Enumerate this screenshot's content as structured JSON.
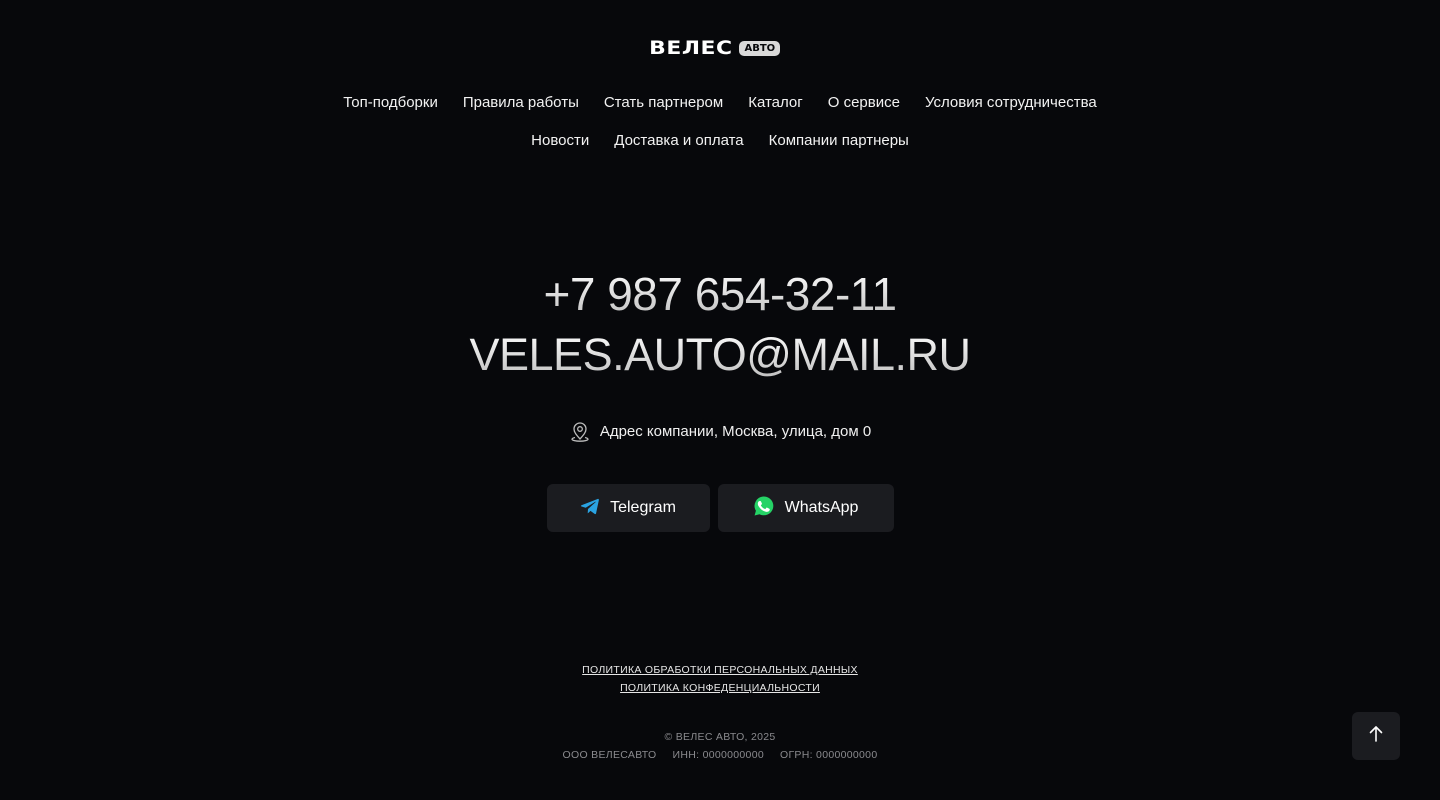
{
  "logo": {
    "word": "ВЕЛЕС",
    "badge": "АВТО"
  },
  "nav": {
    "row1": [
      "Топ-подборки",
      "Правила работы",
      "Стать партнером",
      "Каталог",
      "О сервисе",
      "Условия сотрудничества"
    ],
    "row2": [
      "Новости",
      "Доставка и оплата",
      "Компании партнеры"
    ]
  },
  "contacts": {
    "phone": "+7 987 654-32-11",
    "email": "VELES.AUTO@MAIL.RU",
    "address": "Адрес компании, Москва, улица, дом 0"
  },
  "socials": {
    "telegram_label": "Telegram",
    "whatsapp_label": "WhatsApp"
  },
  "policies": {
    "personal_data": "ПОЛИТИКА ОБРАБОТКИ ПЕРСОНАЛЬНЫХ ДАННЫХ",
    "privacy": "ПОЛИТИКА КОНФЕДЕНЦИАЛЬНОСТИ"
  },
  "legal": {
    "copyright": "© ВЕЛЕС АВТО, 2025",
    "company": "ООО ВЕЛЕСАВТО",
    "inn": "ИНН: 0000000000",
    "ogrn": "ОГРН: 0000000000"
  },
  "colors": {
    "background": "#07080b",
    "button_bg": "#1b1c20",
    "telegram_blue": "#2aa3e2",
    "whatsapp_green": "#25d366",
    "muted_text": "#8a8a8e"
  },
  "icons": {
    "address": "map-pin-icon",
    "telegram": "telegram-icon",
    "whatsapp": "whatsapp-icon",
    "scroll_top": "arrow-up-icon"
  }
}
